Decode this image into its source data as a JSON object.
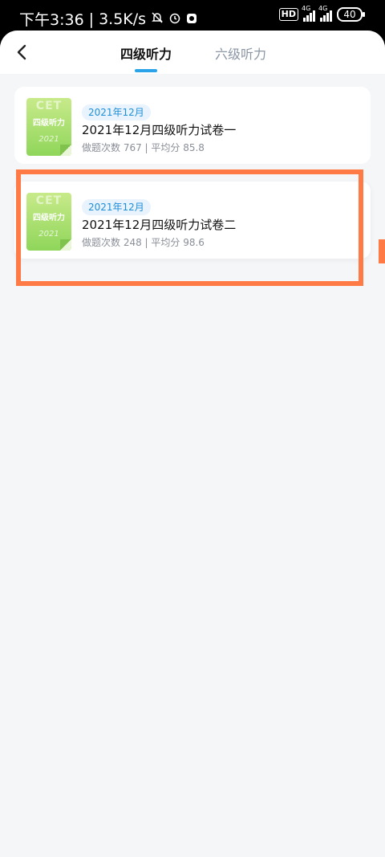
{
  "status_bar": {
    "time": "下午3:36",
    "speed": "3.5K/s",
    "hd_label": "HD",
    "net_type_1": "4G",
    "net_type_2": "4G",
    "battery": "40"
  },
  "nav": {
    "tab_active": "四级听力",
    "tab_inactive": "六级听力"
  },
  "cards": [
    {
      "badge": "2021年12月",
      "title": "2021年12月四级听力试卷一",
      "meta": "做题次数 767 | 平均分 85.8",
      "cover_cet": "CET",
      "cover_title": "四级听力",
      "cover_year": "2021"
    },
    {
      "badge": "2021年12月",
      "title": "2021年12月四级听力试卷二",
      "meta": "做题次数 248 | 平均分 98.6",
      "cover_cet": "CET",
      "cover_title": "四级听力",
      "cover_year": "2021"
    }
  ],
  "colors": {
    "accent": "#2aa3e9",
    "highlight": "#ff7a45",
    "cover_green": "#8fd65a"
  }
}
